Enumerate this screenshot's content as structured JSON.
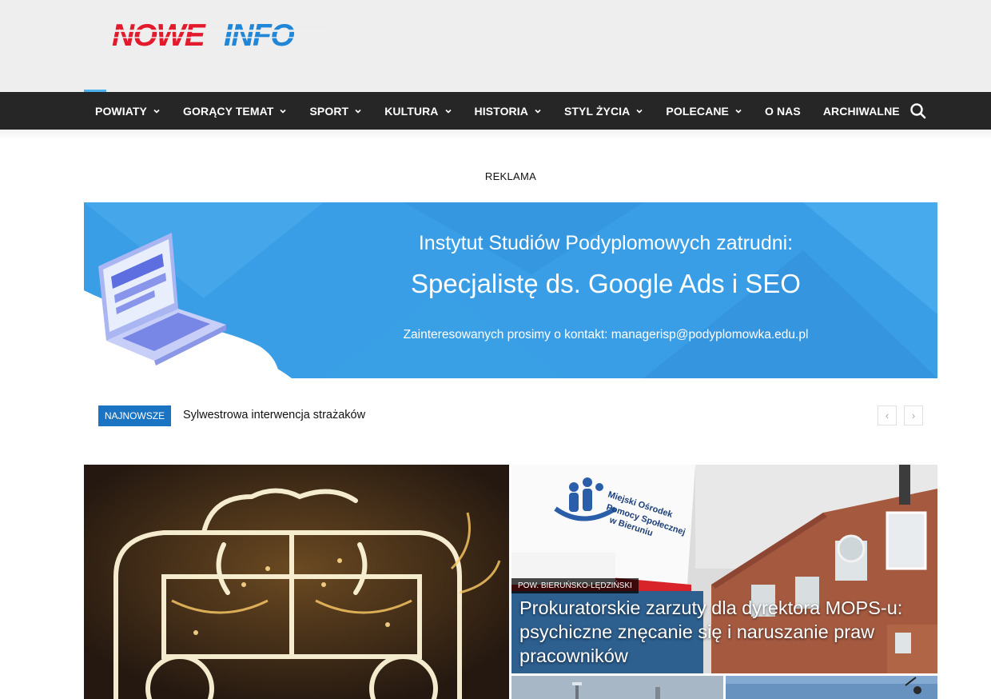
{
  "header": {
    "logo_text": "NOWEINFO"
  },
  "nav": {
    "items": [
      {
        "label": "POWIATY",
        "has_dropdown": true
      },
      {
        "label": "GORĄCY TEMAT",
        "has_dropdown": true
      },
      {
        "label": "SPORT",
        "has_dropdown": true
      },
      {
        "label": "KULTURA",
        "has_dropdown": true
      },
      {
        "label": "HISTORIA",
        "has_dropdown": true
      },
      {
        "label": "STYL ŻYCIA",
        "has_dropdown": true
      },
      {
        "label": "POLECANE",
        "has_dropdown": true
      },
      {
        "label": "O NAS",
        "has_dropdown": false
      },
      {
        "label": "ARCHIWALNE",
        "has_dropdown": false
      }
    ],
    "search_icon": "search-icon"
  },
  "ad": {
    "label": "REKLAMA",
    "title": "Instytut Studiów Podyplomowych zatrudni:",
    "headline": "Specjalistę ds. Google Ads i SEO",
    "contact": "Zainteresowanych prosimy o kontakt: managerisp@podyplomowka.edu.pl"
  },
  "ticker": {
    "badge": "NAJNOWSZE",
    "headline": "Sylwestrowa interwencja strażaków",
    "prev_icon": "chevron-left-icon",
    "next_icon": "chevron-right-icon"
  },
  "featured": {
    "main": {
      "category": "POW. BIERUŃSKO-LĘDZIŃSKI",
      "title": "Prokuratorskie zarzuty dla dyrektora MOPS-u: psychiczne znęcanie się i naruszanie praw pracowników"
    }
  },
  "colors": {
    "nav_bg": "#262626",
    "accent_blue": "#1b74c2",
    "logo_red": "#e3192c",
    "logo_blue": "#1f86d8",
    "ad_blue": "#3a9ee6"
  }
}
